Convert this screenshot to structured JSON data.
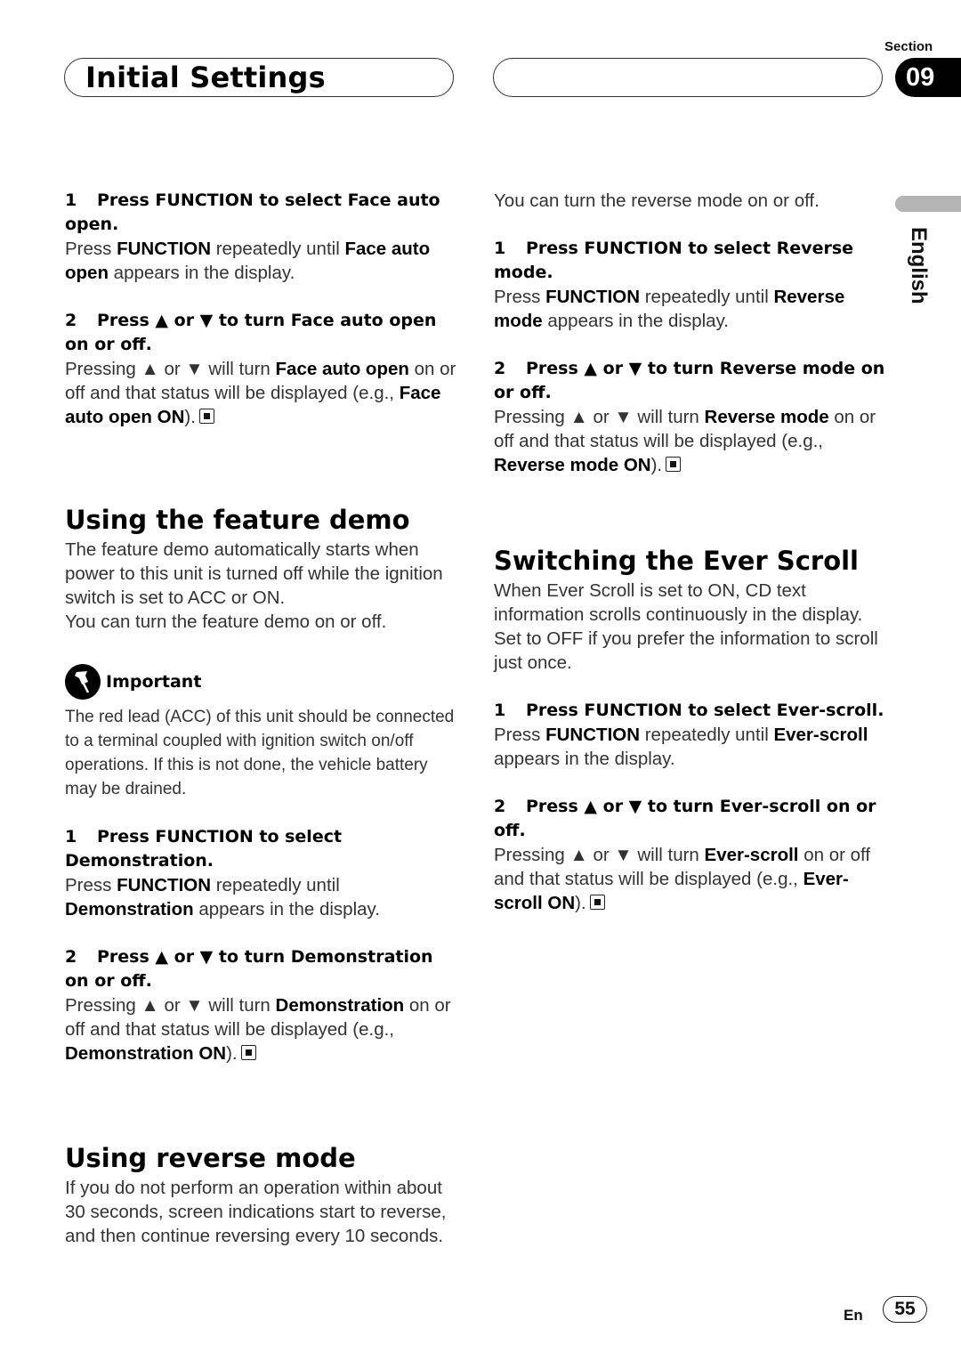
{
  "header": {
    "title": "Initial Settings",
    "section_label": "Section",
    "section_number": "09",
    "language": "English"
  },
  "left": {
    "face_auto_open": {
      "step1_num": "1",
      "step1_title": "Press FUNCTION to select Face auto open.",
      "step1_body": [
        {
          "t": "Press ",
          "b": false
        },
        {
          "t": "FUNCTION",
          "b": true
        },
        {
          "t": " repeatedly until ",
          "b": false
        },
        {
          "t": "Face auto open",
          "b": true
        },
        {
          "t": " appears in the display.",
          "b": false
        }
      ],
      "step2_num": "2",
      "step2_title": "Press ▲ or ▼ to turn Face auto open on or off.",
      "step2_body": [
        {
          "t": "Pressing ▲ or ▼ will turn ",
          "b": false
        },
        {
          "t": "Face auto open",
          "b": true
        },
        {
          "t": " on or off and that status will be displayed (e.g., ",
          "b": false
        },
        {
          "t": "Face auto open ON",
          "b": true
        },
        {
          "t": ").",
          "b": false
        }
      ]
    },
    "feature_demo": {
      "heading": "Using the feature demo",
      "intro": "The feature demo automatically starts when power to this unit is turned off while the ignition switch is set to ACC or ON.",
      "intro2": "You can turn the feature demo on or off.",
      "important_label": "Important",
      "important_text": "The red lead (ACC) of this unit should be connected to a terminal coupled with ignition switch on/off operations. If this is not done, the vehicle battery may be drained.",
      "step1_num": "1",
      "step1_title": "Press FUNCTION to select Demonstration.",
      "step1_body": [
        {
          "t": "Press ",
          "b": false
        },
        {
          "t": "FUNCTION",
          "b": true
        },
        {
          "t": " repeatedly until ",
          "b": false
        },
        {
          "t": "Demonstration",
          "b": true
        },
        {
          "t": " appears in the display.",
          "b": false
        }
      ],
      "step2_num": "2",
      "step2_title": "Press ▲ or ▼ to turn Demonstration on or off.",
      "step2_body": [
        {
          "t": "Pressing ▲ or ▼ will turn ",
          "b": false
        },
        {
          "t": "Demonstration",
          "b": true
        },
        {
          "t": " on or off and that status will be displayed (e.g., ",
          "b": false
        },
        {
          "t": "Demonstration ON",
          "b": true
        },
        {
          "t": ").",
          "b": false
        }
      ]
    },
    "reverse_mode": {
      "heading": "Using reverse mode",
      "intro": "If you do not perform an operation within about 30 seconds, screen indications start to reverse, and then continue reversing every 10 seconds."
    }
  },
  "right": {
    "reverse_mode": {
      "intro": "You can turn the reverse mode on or off.",
      "step1_num": "1",
      "step1_title": "Press FUNCTION to select Reverse mode.",
      "step1_body": [
        {
          "t": "Press ",
          "b": false
        },
        {
          "t": "FUNCTION",
          "b": true
        },
        {
          "t": " repeatedly until ",
          "b": false
        },
        {
          "t": "Reverse mode",
          "b": true
        },
        {
          "t": " appears in the display.",
          "b": false
        }
      ],
      "step2_num": "2",
      "step2_title": "Press ▲ or ▼ to turn Reverse mode on or off.",
      "step2_body": [
        {
          "t": "Pressing ▲ or ▼ will turn ",
          "b": false
        },
        {
          "t": "Reverse mode",
          "b": true
        },
        {
          "t": " on or off and that status will be displayed (e.g., ",
          "b": false
        },
        {
          "t": "Reverse mode ON",
          "b": true
        },
        {
          "t": ").",
          "b": false
        }
      ]
    },
    "ever_scroll": {
      "heading": "Switching the Ever Scroll",
      "intro": "When Ever Scroll is set to ON, CD text information scrolls continuously in the display. Set to OFF if you prefer the information to scroll just once.",
      "step1_num": "1",
      "step1_title": "Press FUNCTION to select Ever-scroll.",
      "step1_body": [
        {
          "t": "Press ",
          "b": false
        },
        {
          "t": "FUNCTION",
          "b": true
        },
        {
          "t": " repeatedly until ",
          "b": false
        },
        {
          "t": "Ever-scroll",
          "b": true
        },
        {
          "t": " appears in the display.",
          "b": false
        }
      ],
      "step2_num": "2",
      "step2_title": "Press ▲ or ▼ to turn Ever-scroll on or off.",
      "step2_body": [
        {
          "t": "Pressing ▲ or ▼ will turn ",
          "b": false
        },
        {
          "t": "Ever-scroll",
          "b": true
        },
        {
          "t": " on or off and that status will be displayed (e.g., ",
          "b": false
        },
        {
          "t": "Ever-scroll ON",
          "b": true
        },
        {
          "t": ").",
          "b": false
        }
      ]
    }
  },
  "footer": {
    "lang_code": "En",
    "page_number": "55"
  }
}
